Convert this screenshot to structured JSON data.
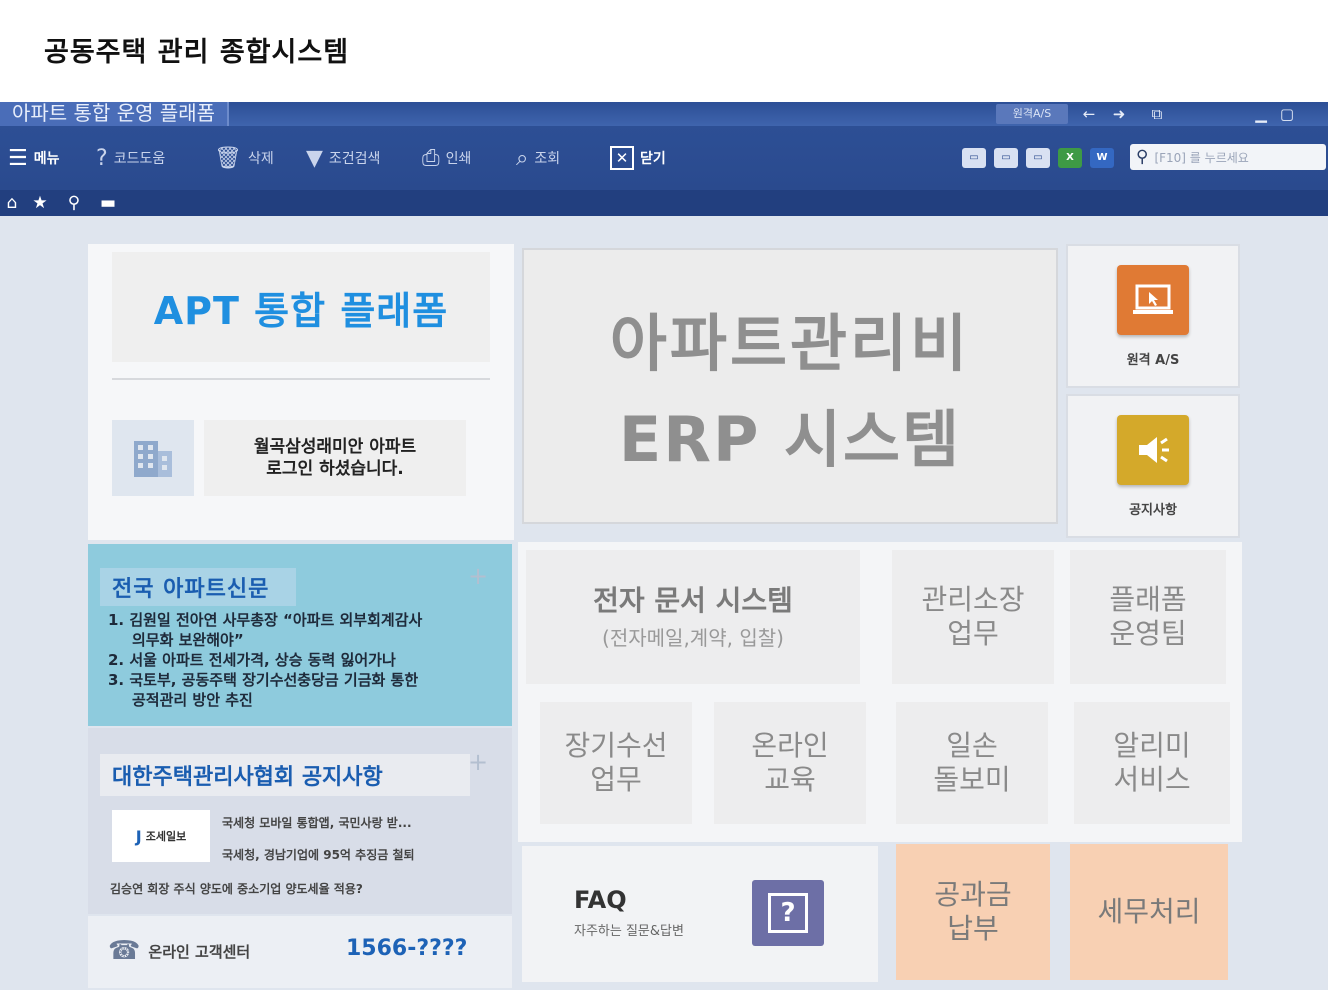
{
  "page_title": "공동주택 관리 종합시스템",
  "titlebar": {
    "app_title": "아파트 통합 운영 플래폼",
    "remote_label": "원격A/S",
    "icons": [
      "back-arrow-icon",
      "forward-arrow-icon",
      "window-icon",
      "minimize-icon",
      "maximize-icon"
    ]
  },
  "toolbar": {
    "menu": "메뉴",
    "help": "코드도움",
    "delete": "삭제",
    "filter": "조건검색",
    "print": "인쇄",
    "lookup": "조회",
    "close": "닫기",
    "mini_icons": [
      "▭",
      "▭",
      "▭",
      "X",
      "W"
    ],
    "search_placeholder": "[F10] 를 누르세요"
  },
  "left": {
    "apt_title": "APT 통합 플래폼",
    "login_line1": "월곡삼성래미안 아파트",
    "login_line2": "로그인 하셨습니다."
  },
  "news": {
    "heading": "전국 아파트신문",
    "items": [
      "1. 김원일 전아연 사무총장 “아파트 외부회계감사",
      "의무화 보완해야”",
      "2. 서울 아파트 전세가격, 상승 동력 잃어가나",
      "3. 국토부, 공동주택 장기수선충당금 기금화 통한",
      "공적관리 방안 추진"
    ]
  },
  "association": {
    "heading": "대한주택관리사협회 공지사항",
    "logo_text": "조세일보",
    "items": [
      "국세청 모바일 통합앱, 국민사랑 받...",
      "국세청, 경남기업에 95억 추징금 철퇴",
      "김승연 회장 주식 양도에 중소기업 양도세율 적용?"
    ]
  },
  "customer_center": {
    "label": "온라인 고객센터",
    "phone": "1566-????"
  },
  "erp": {
    "line1": "아파트관리비",
    "line2": "ERP 시스템"
  },
  "side_tiles": {
    "remote_as": "원격 A/S",
    "notice": "공지사항"
  },
  "grid": {
    "edoc_title": "전자 문서 시스템",
    "edoc_sub": "(전자메일,계약, 입찰)",
    "manager_l1": "관리소장",
    "manager_l2": "업무",
    "platform_l1": "플래폼",
    "platform_l2": "운영팀",
    "repair_l1": "장기수선",
    "repair_l2": "업무",
    "online_l1": "온라인",
    "online_l2": "교육",
    "jobs_l1": "일손",
    "jobs_l2": "돌보미",
    "alert_l1": "알리미",
    "alert_l2": "서비스",
    "faq_title": "FAQ",
    "faq_sub": "자주하는 질문&답변",
    "utility_l1": "공과금",
    "utility_l2": "납부",
    "tax": "세무처리"
  },
  "colors": {
    "accent_blue": "#1f8fe0",
    "orange_icon": "#e07a34",
    "yellow_icon": "#d4a92a",
    "peach_tile": "#f8d0b3",
    "news_bg": "#8ecbdd"
  }
}
